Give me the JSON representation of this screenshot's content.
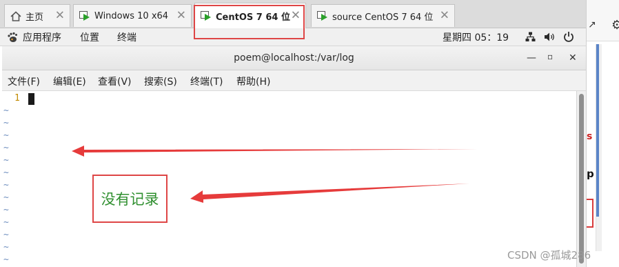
{
  "tabs": [
    {
      "label": "主页",
      "icon": "home-icon"
    },
    {
      "label": "Windows 10 x64",
      "icon": "vm-icon"
    },
    {
      "label": "CentOS 7 64 位",
      "icon": "vm-icon",
      "active": true
    },
    {
      "label": "source CentOS 7 64 位",
      "icon": "vm-icon"
    }
  ],
  "tab_close_glyph": "✕",
  "gnome_bar": {
    "applications": "应用程序",
    "places": "位置",
    "terminal": "终端",
    "clock": "星期四  05：19"
  },
  "terminal": {
    "title": "poem@localhost:/var/log",
    "menu": [
      "文件(F)",
      "编辑(E)",
      "查看(V)",
      "搜索(S)",
      "终端(T)",
      "帮助(H)"
    ],
    "line_number": "1",
    "tilde": "~"
  },
  "annotation": {
    "text": "没有记录",
    "color": "#de4545",
    "text_color": "#2f8f2f"
  },
  "right_pane": {
    "letter_s": "s",
    "letter_p": "p"
  },
  "watermark": "CSDN @孤城286"
}
